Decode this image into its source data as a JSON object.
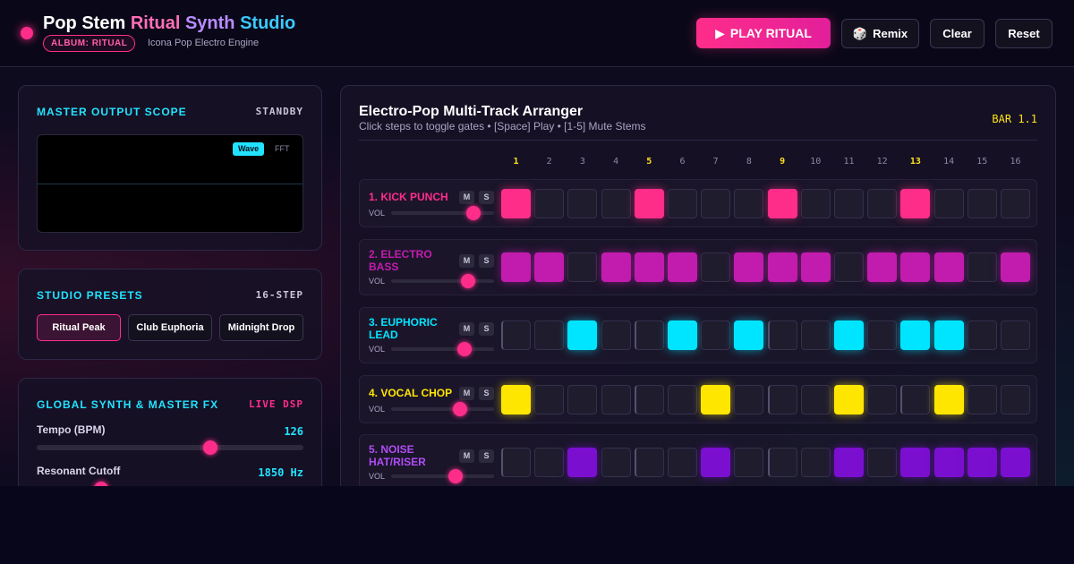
{
  "header": {
    "title_parts": [
      "Pop Stem",
      "Ritual",
      "Synth",
      "Studio"
    ],
    "album_badge": "ALBUM: RITUAL",
    "engine": "Icona Pop Electro Engine",
    "play_icon": "▶",
    "play_label": "PLAY RITUAL",
    "remix_icon": "🎲",
    "remix_label": "Remix",
    "clear_label": "Clear",
    "reset_label": "Reset"
  },
  "scope_panel": {
    "title": "MASTER OUTPUT SCOPE",
    "status": "STANDBY",
    "tabs": [
      {
        "label": "Wave",
        "active": true
      },
      {
        "label": "FFT",
        "active": false
      }
    ]
  },
  "presets_panel": {
    "title": "STUDIO PRESETS",
    "tag": "16-STEP",
    "presets": [
      {
        "label": "Ritual Peak",
        "active": true
      },
      {
        "label": "Club Euphoria",
        "active": false
      },
      {
        "label": "Midnight Drop",
        "active": false
      }
    ]
  },
  "synth_panel": {
    "title": "GLOBAL SYNTH & MASTER FX",
    "tag": "LIVE DSP",
    "params": [
      {
        "label": "Tempo (BPM)",
        "value": "126",
        "level": 0.65
      },
      {
        "label": "Resonant Cutoff",
        "value": "1850 Hz",
        "level": 0.24
      }
    ]
  },
  "arranger": {
    "title": "Electro-Pop Multi-Track Arranger",
    "subtitle": "Click steps to toggle gates • [Space] Play • [1-5] Mute Stems",
    "bar": "BAR 1.1",
    "steps": [
      "1",
      "2",
      "3",
      "4",
      "5",
      "6",
      "7",
      "8",
      "9",
      "10",
      "11",
      "12",
      "13",
      "14",
      "15",
      "16"
    ],
    "mute_label": "M",
    "solo_label": "S",
    "vol_label": "VOL",
    "tracks": [
      {
        "name": "1. KICK PUNCH",
        "color": "#ff2d8a",
        "volume": 0.8,
        "pattern": [
          1,
          0,
          0,
          0,
          1,
          0,
          0,
          0,
          1,
          0,
          0,
          0,
          1,
          0,
          0,
          0
        ]
      },
      {
        "name": "2. ELECTRO BASS",
        "color": "#c21cae",
        "volume": 0.75,
        "pattern": [
          1,
          1,
          0,
          1,
          1,
          1,
          0,
          1,
          1,
          1,
          0,
          1,
          1,
          1,
          0,
          1
        ]
      },
      {
        "name": "3. EUPHORIC LEAD",
        "color": "#00e5ff",
        "volume": 0.71,
        "pattern": [
          0,
          0,
          1,
          0,
          0,
          1,
          0,
          1,
          0,
          0,
          1,
          0,
          1,
          1,
          0,
          0
        ]
      },
      {
        "name": "4. VOCAL CHOP",
        "color": "#ffe600",
        "volume": 0.67,
        "pattern": [
          1,
          0,
          0,
          0,
          0,
          0,
          1,
          0,
          0,
          0,
          1,
          0,
          0,
          1,
          0,
          0
        ]
      },
      {
        "name": "5. NOISE HAT/RISER",
        "color": "#7a0fd0",
        "volume": 0.63,
        "pattern": [
          0,
          0,
          1,
          0,
          0,
          0,
          1,
          0,
          0,
          0,
          1,
          0,
          1,
          1,
          1,
          1
        ]
      }
    ]
  }
}
